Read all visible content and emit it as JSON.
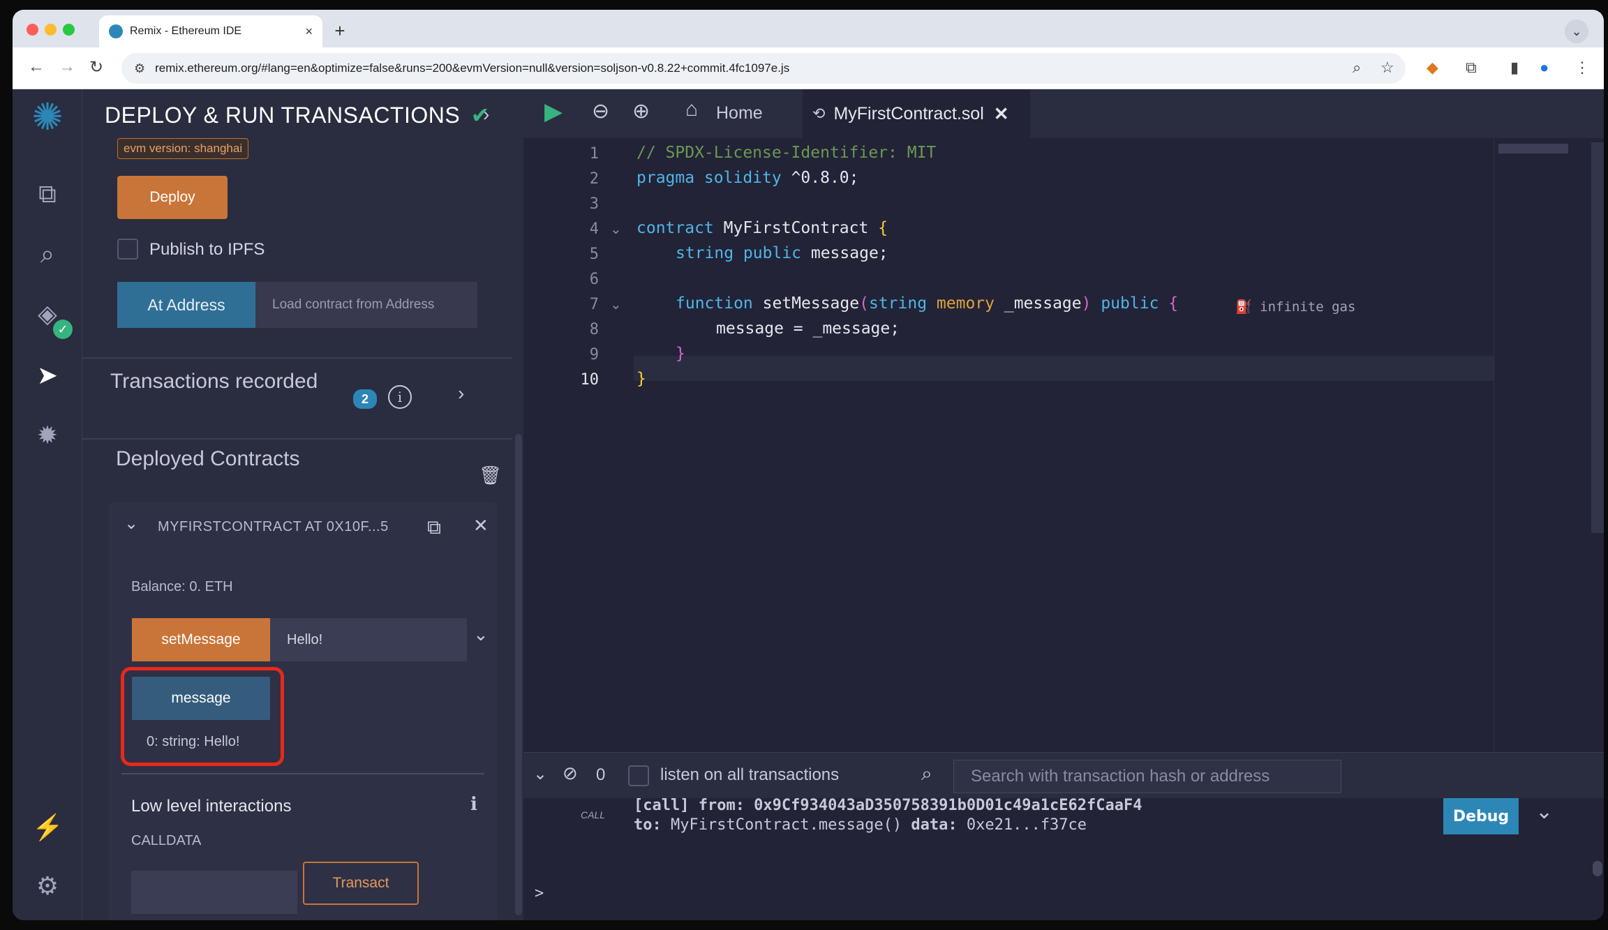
{
  "browser": {
    "tab_title": "Remix - Ethereum IDE",
    "tab_close": "×",
    "new_tab": "+",
    "url": "remix.ethereum.org/#lang=en&optimize=false&runs=200&evmVersion=null&version=soljson-v0.8.22+commit.4fc1097e.js"
  },
  "panel": {
    "title": "DEPLOY & RUN TRANSACTIONS",
    "evm_badge": "evm version: shanghai",
    "deploy_label": "Deploy",
    "publish_ipfs": "Publish to IPFS",
    "at_address_label": "At Address",
    "load_address_placeholder": "Load contract from Address",
    "transactions_recorded": "Transactions recorded",
    "transactions_count": "2",
    "deployed_contracts": "Deployed Contracts",
    "contract_name": "MYFIRSTCONTRACT AT 0X10F...5",
    "balance": "Balance: 0. ETH",
    "set_message_label": "setMessage",
    "set_message_value": "Hello!",
    "message_label": "message",
    "message_result": "0: string: Hello!",
    "low_level": "Low level interactions",
    "calldata": "CALLDATA",
    "transact_label": "Transact"
  },
  "editor": {
    "home_tab": "Home",
    "file_tab": "MyFirstContract.sol",
    "gas_hint": "infinite gas",
    "line_numbers": [
      "1",
      "2",
      "3",
      "4",
      "5",
      "6",
      "7",
      "8",
      "9",
      "10"
    ],
    "lines": {
      "l1": "// SPDX-License-Identifier: MIT",
      "l2_kw": "pragma solidity",
      "l2_rest": " ^0.8.0;",
      "l4_kw": "contract",
      "l4_name": " MyFirstContract ",
      "l4_brace": "{",
      "l5_type": "string public",
      "l5_rest": " message;",
      "l7_kw": "function",
      "l7_name": " setMessage",
      "l7_paren": "(",
      "l7_type": "string",
      "l7_mem": " memory",
      "l7_arg": " _message",
      "l7_close": ")",
      "l7_pub": " public",
      "l7_brace": " {",
      "l8": "message = _message;",
      "l9": "}",
      "l10": "}"
    }
  },
  "terminal": {
    "count": "0",
    "listen_label": "listen on all transactions",
    "search_placeholder": "Search with transaction hash or address",
    "call_badge": "CALL",
    "log_line1": "[call] from: 0x9Cf934043aD350758391b0D01c49a1cE62fCaaF4",
    "log_to_kw": "to:",
    "log_to_val": " MyFirstContract.message() ",
    "log_data_kw": "data:",
    "log_data_val": " 0xe21...f37ce",
    "debug_label": "Debug",
    "prompt": ">"
  },
  "colors": {
    "accent_orange": "#c97539",
    "accent_blue": "#2c87b7",
    "highlight_red": "#e9281b"
  }
}
